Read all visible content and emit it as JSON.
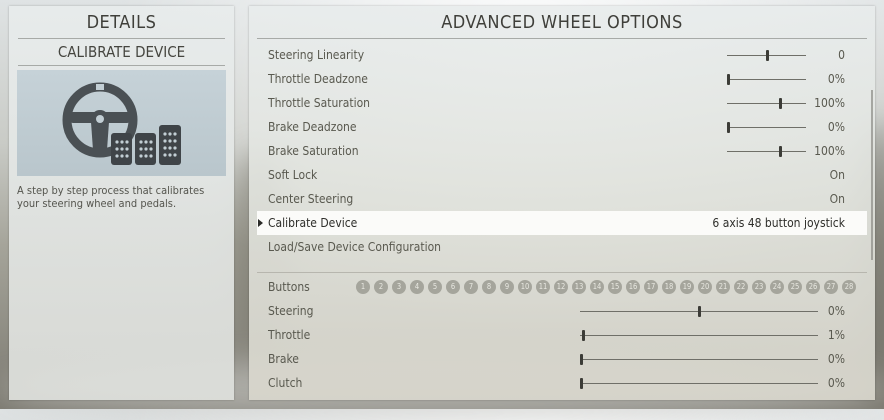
{
  "details": {
    "title": "DETAILS",
    "subtitle": "CALIBRATE DEVICE",
    "description": "A step by step process that calibrates your steering wheel and pedals."
  },
  "options": {
    "title": "ADVANCED WHEEL OPTIONS",
    "items": [
      {
        "label": "Steering Linearity",
        "value": "0",
        "slider": 0.5
      },
      {
        "label": "Throttle Deadzone",
        "value": "0%",
        "slider": 0.0
      },
      {
        "label": "Throttle Saturation",
        "value": "100%",
        "slider": 0.68
      },
      {
        "label": "Brake Deadzone",
        "value": "0%",
        "slider": 0.0
      },
      {
        "label": "Brake Saturation",
        "value": "100%",
        "slider": 0.68
      },
      {
        "label": "Soft Lock",
        "value": "On"
      },
      {
        "label": "Center Steering",
        "value": "On"
      },
      {
        "label": "Calibrate Device",
        "value": "6 axis 48 button joystick",
        "selected": true
      },
      {
        "label": "Load/Save Device Configuration",
        "value": ""
      }
    ]
  },
  "inputs": {
    "buttons_label": "Buttons",
    "buttons": [
      "1",
      "2",
      "3",
      "4",
      "5",
      "6",
      "7",
      "8",
      "9",
      "10",
      "11",
      "12",
      "13",
      "14",
      "15",
      "16",
      "17",
      "18",
      "19",
      "20",
      "21",
      "22",
      "23",
      "24",
      "25",
      "26",
      "27",
      "28"
    ],
    "axes": [
      {
        "label": "Steering",
        "value": "0%",
        "level": 0.5
      },
      {
        "label": "Throttle",
        "value": "1%",
        "level": 0.01
      },
      {
        "label": "Brake",
        "value": "0%",
        "level": 0.0
      },
      {
        "label": "Clutch",
        "value": "0%",
        "level": 0.0
      }
    ]
  }
}
